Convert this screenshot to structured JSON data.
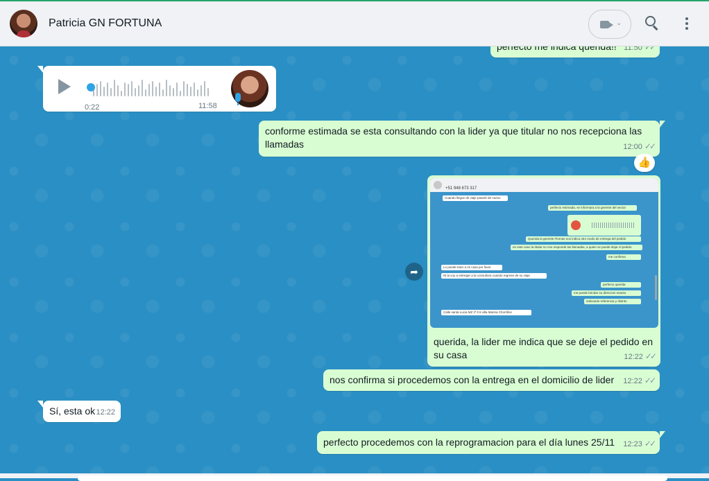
{
  "header": {
    "contact_name": "Patricia GN FORTUNA",
    "icons": [
      "avatar",
      "video-call-icon",
      "chevron-down-icon",
      "search-icon",
      "menu-icon"
    ]
  },
  "messages": {
    "m0": {
      "text": "perfecto me indica querida!!",
      "time": "11:50",
      "status": "read"
    },
    "m1": {
      "type": "voice-note",
      "duration": "0:22",
      "time": "11:58"
    },
    "m2": {
      "text": "conforme estimada se esta consultando con la lider ya que titular no nos recepciona las llamadas",
      "time": "12:00",
      "reaction": "👍"
    },
    "m3": {
      "caption": "querida, la lider me indica que se deje el pedido en su casa",
      "time": "12:22"
    },
    "m4": {
      "text": "nos confirma si procedemos con la entrega en el domicilio de lider",
      "time": "12:22"
    },
    "m5": {
      "text": "Sí, esta ok",
      "time": "12:22"
    },
    "m6": {
      "text": "perfecto procedemos con la reprogramacion para el día lunes 25/11",
      "time": "12:23"
    }
  },
  "screenshot": {
    "title": "+51 948 673 317",
    "lines": [
      "Cuando llegue de viaje pasaré de nuevo",
      "perfecto estimada, se informara a la gerente del sector",
      "Querida la gerente Flornas nos indica otro modo de entrega del pedido",
      "en este caso la titular no nos responde las llamadas, a quien se puede dejar el pedido",
      "me confirma",
      "Lo puede traer a mi casa por favor",
      "Ni la voy a entregar a la consultora cuando regrese de su viaje",
      "perfecto querida",
      "me puede brindar su direccion exacta",
      "indicando referencia y distrito",
      "Calle santa Lucia MZ I7 lt 6 villa Marina Chorrillos"
    ]
  },
  "ticks": "✓✓",
  "colors": {
    "outgoing": "#d9fdd3",
    "incoming": "#ffffff",
    "wallpaper": "#2a8fc4",
    "accent": "#2ea4e5"
  }
}
